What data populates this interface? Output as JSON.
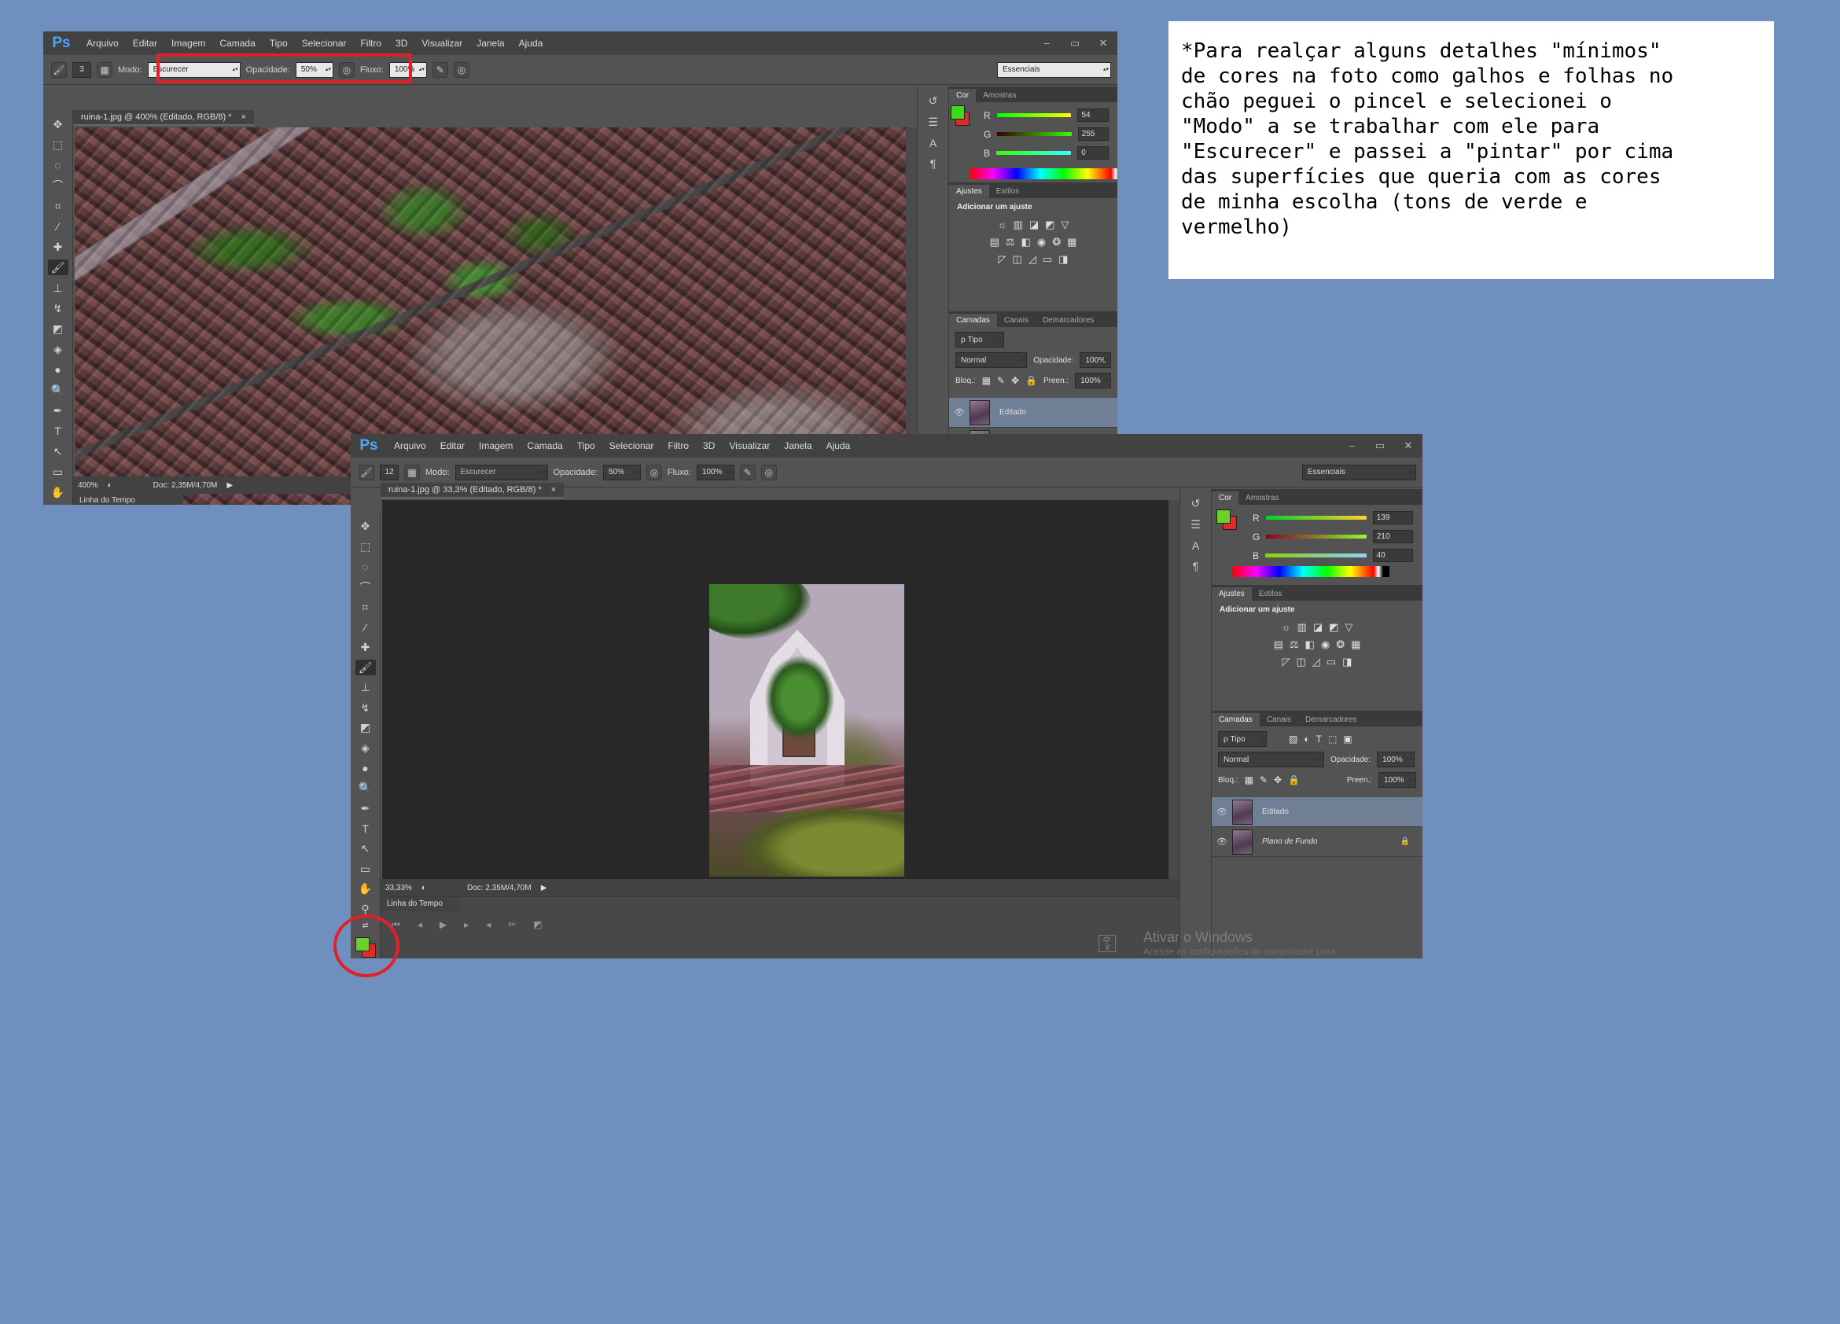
{
  "menu": [
    "Arquivo",
    "Editar",
    "Imagem",
    "Camada",
    "Tipo",
    "Selecionar",
    "Filtro",
    "3D",
    "Visualizar",
    "Janela",
    "Ajuda"
  ],
  "app_logo": "Ps",
  "window_controls": [
    "–",
    "▭",
    "✕"
  ],
  "workspace": "Essenciais",
  "options": {
    "mode_label": "Modo:",
    "mode_value": "Escurecer",
    "opacity_label": "Opacidade:",
    "opacity_value": "50%",
    "flow_label": "Fluxo:",
    "flow_value": "100%"
  },
  "window1": {
    "brush_size": "3",
    "doc_tab": "ruina-1.jpg @ 400% (Editado, RGB/8) *",
    "tab_close": "×",
    "zoom": "400%",
    "doc_size": "Doc: 2,35M/4,70M",
    "timeline_label": "Linha do Tempo",
    "color_rgb": {
      "r": "54",
      "g": "255",
      "b": "0"
    }
  },
  "window2": {
    "brush_size": "12",
    "doc_tab": "ruina-1.jpg @ 33,3% (Editado, RGB/8) *",
    "tab_close": "×",
    "zoom": "33,33%",
    "doc_size": "Doc: 2,35M/4,70M",
    "timeline_label": "Linha do Tempo",
    "color_rgb": {
      "r": "139",
      "g": "210",
      "b": "40"
    },
    "watermark_title": "Ativar o Windows",
    "watermark_sub": "Acesse as configurações do computador para"
  },
  "panels": {
    "color_tabs": [
      "Cor",
      "Amostras"
    ],
    "channel_labels": [
      "R",
      "G",
      "B"
    ],
    "adjust_tabs": [
      "Ajustes",
      "Estilos"
    ],
    "adjust_title": "Adicionar um ajuste",
    "layer_tabs": [
      "Camadas",
      "Canais",
      "Demarcadores"
    ],
    "filter_kind": "ρ Tipo",
    "blend_mode": "Normal",
    "opacity_label": "Opacidade:",
    "opacity_value": "100%",
    "lock_label": "Bloq.:",
    "fill_label": "Preen.:",
    "fill_value": "100%",
    "layers": [
      {
        "name": "Editado",
        "selected": true
      },
      {
        "name": "Plano de Fundo",
        "selected": false
      }
    ]
  },
  "colors": {
    "foreground": "#3fd91c",
    "background": "#e02a24",
    "annotation": "#e3202a"
  },
  "note": "*Para realçar alguns detalhes \"mínimos\"\nde cores na foto como galhos e folhas no\nchão peguei o pincel e selecionei o\n\"Modo\" a se trabalhar com ele para\n\"Escurecer\" e passei a \"pintar\" por cima\ndas superfícies que queria com as cores\nde minha escolha (tons de verde e\nvermelho)"
}
